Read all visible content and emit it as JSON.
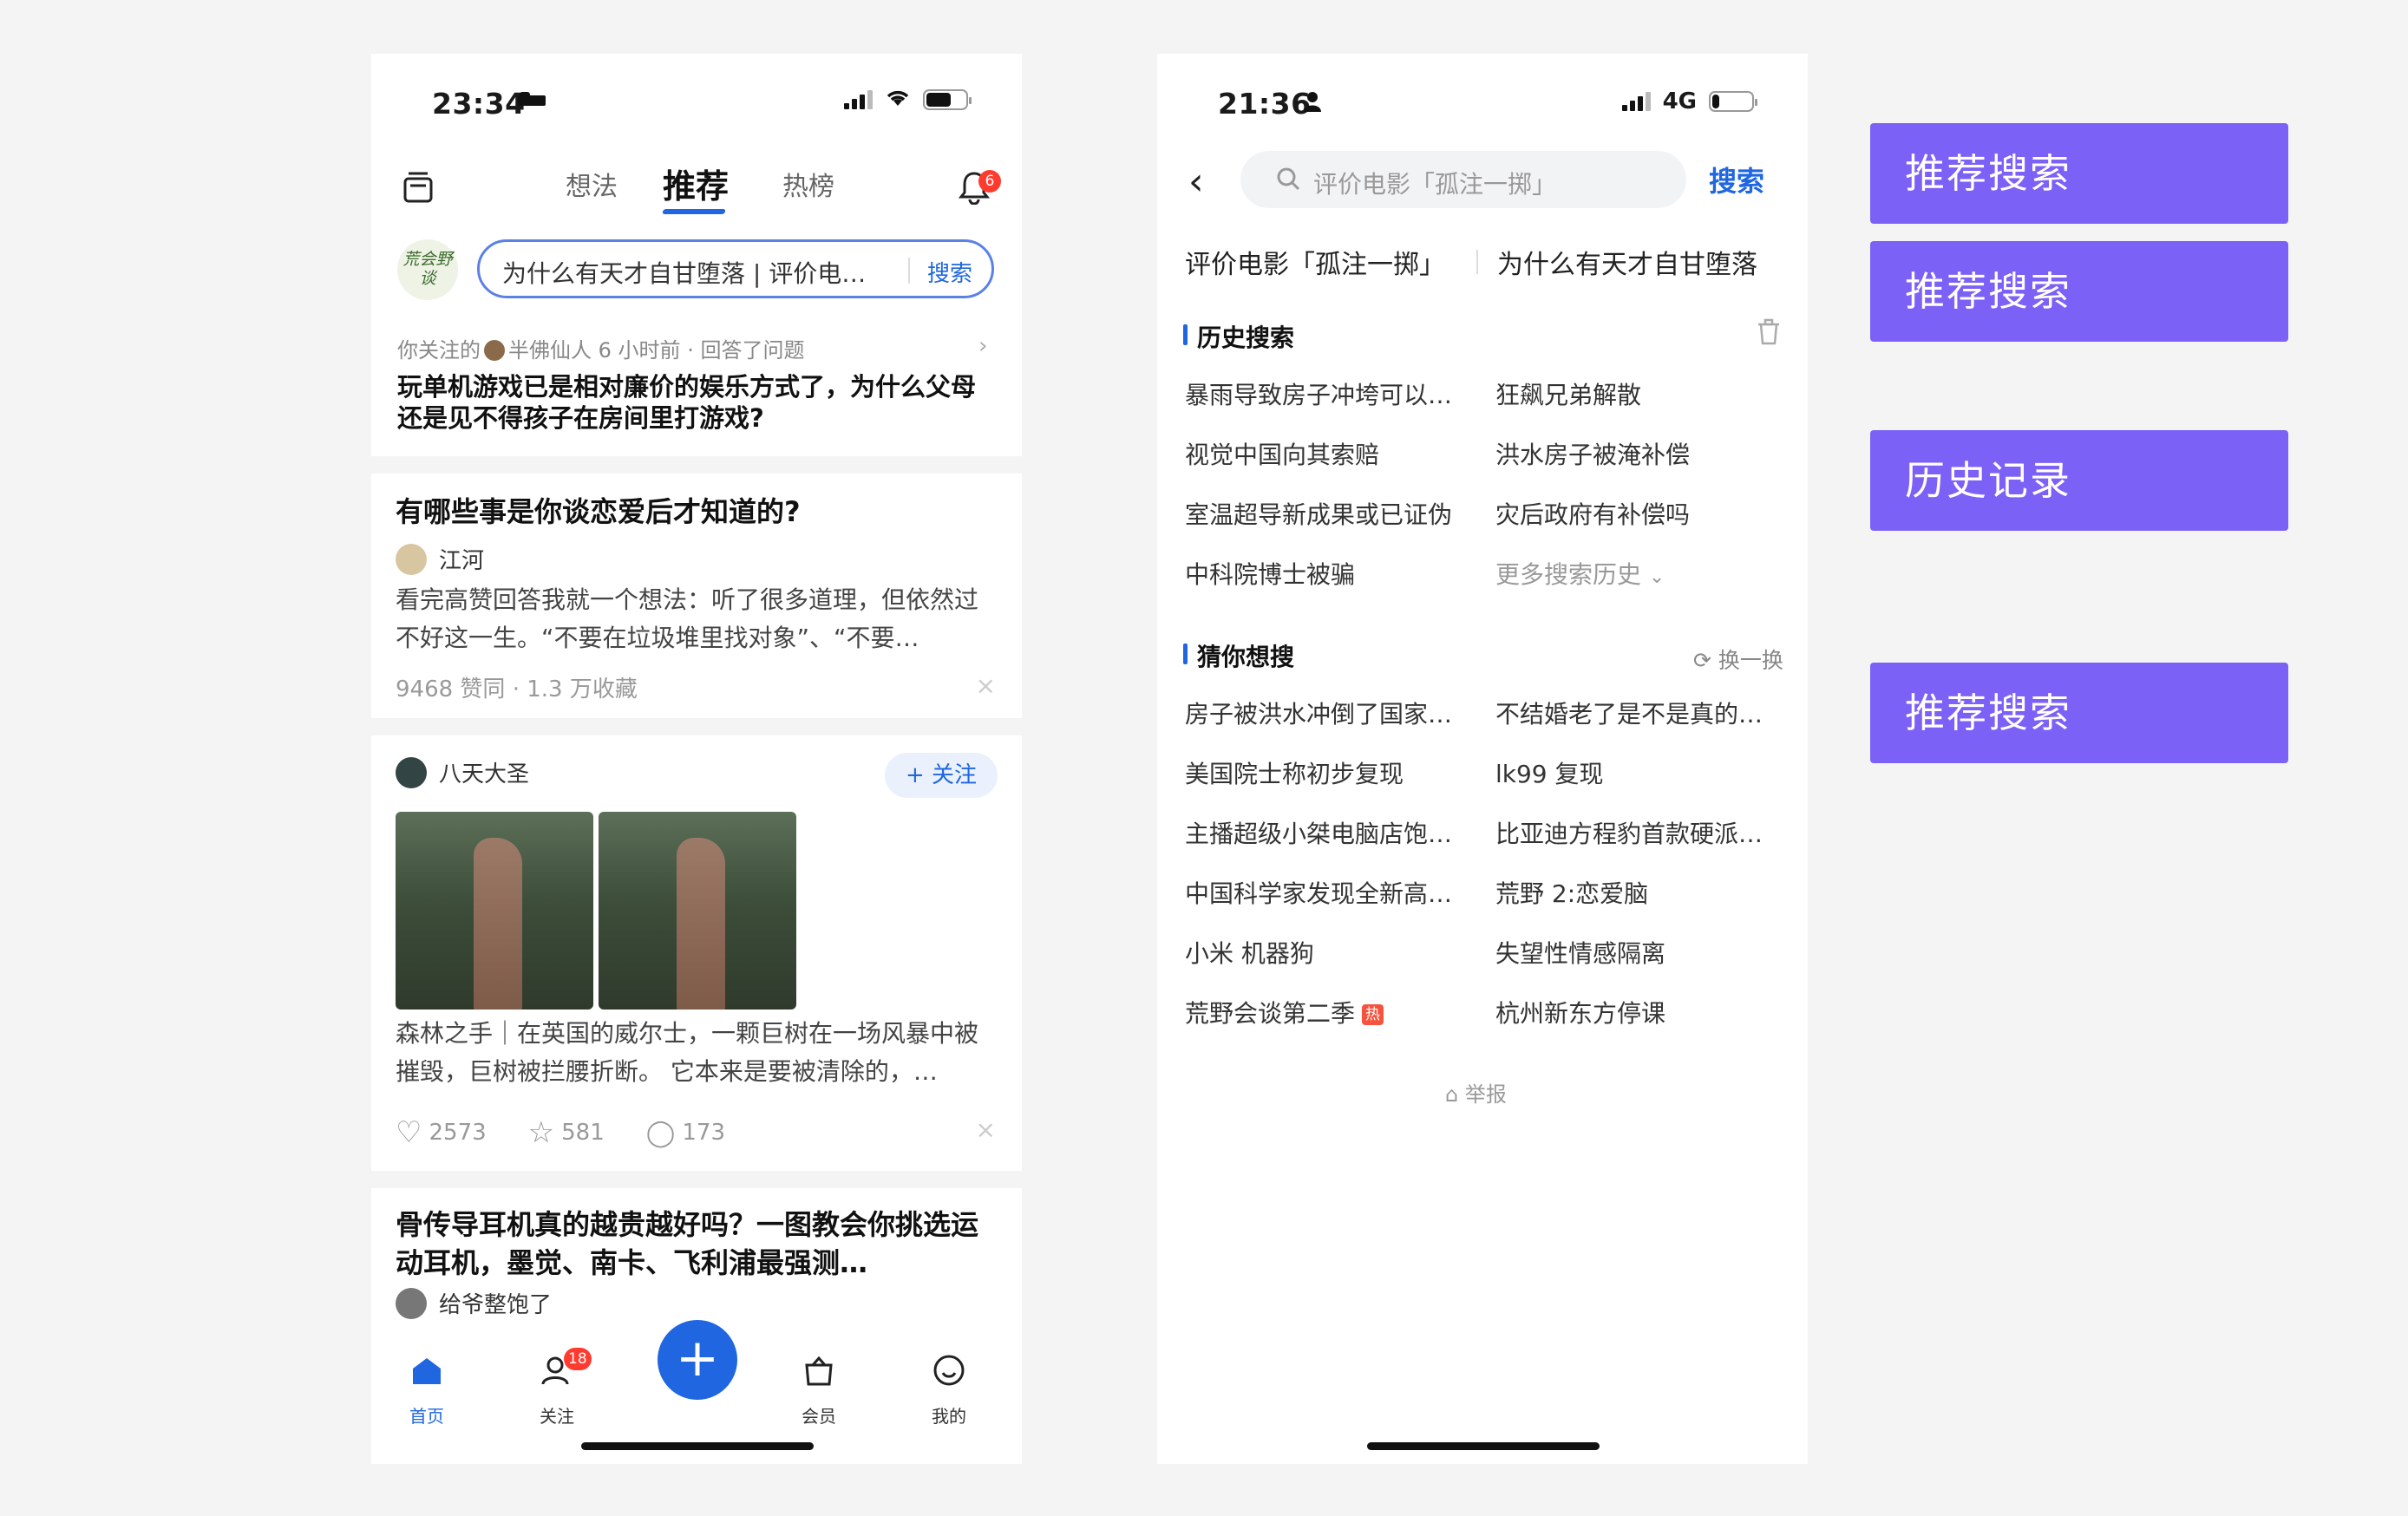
{
  "phone1": {
    "status": {
      "time": "23:34"
    },
    "tabs": [
      "想法",
      "推荐",
      "热榜"
    ],
    "bell_badge": "6",
    "search": {
      "query": "为什么有天才自甘堕落 | 评价电影「孤注一掷」",
      "button": "搜索"
    },
    "avatar_text": "荒会野谈",
    "follow": {
      "prefix": "你关注的",
      "name": "半佛仙人",
      "time": "6 小时前",
      "action": "· 回答了问题",
      "title": "玩单机游戏已是相对廉价的娱乐方式了，为什么父母还是见不得孩子在房间里打游戏?"
    },
    "card1": {
      "title": "有哪些事是你谈恋爱后才知道的?",
      "author": "江河",
      "excerpt": "看完高赞回答我就一个想法：听了很多道理，但依然过不好这一生。“不要在垃圾堆里找对象”、“不要…",
      "meta": "9468 赞同 · 1.3 万收藏"
    },
    "card2": {
      "author": "八天大圣",
      "follow": "+ 关注",
      "excerpt": "森林之手｜在英国的威尔士，一颗巨树在一场风暴中被摧毁，巨树被拦腰折断。 它本来是要被清除的，…",
      "likes": "2573",
      "stars": "581",
      "comments": "173"
    },
    "card3": {
      "title": "骨传导耳机真的越贵越好吗？一图教会你挑选运动耳机，墨觉、南卡、飞利浦最强测…",
      "author": "给爷整饱了"
    },
    "tabbar": {
      "home": "首页",
      "follow": "关注",
      "follow_badge": "18",
      "member": "会员",
      "me": "我的"
    }
  },
  "phone2": {
    "status": {
      "time": "21:36",
      "network": "4G"
    },
    "search": {
      "placeholder": "评价电影「孤注一掷」",
      "button": "搜索"
    },
    "hot_terms": [
      "评价电影「孤注一掷」",
      "为什么有天才自甘堕落"
    ],
    "history": {
      "title": "历史搜索",
      "items": [
        "暴雨导致房子冲垮可以…",
        "狂飙兄弟解散",
        "视觉中国向其索赔",
        "洪水房子被淹补偿",
        "室温超导新成果或已证伪",
        "灾后政府有补偿吗",
        "中科院博士被骗"
      ],
      "more": "更多搜索历史"
    },
    "guess": {
      "title": "猜你想搜",
      "refresh": "换一换",
      "items": [
        "房子被洪水冲倒了国家…",
        "不结婚老了是不是真的…",
        "美国院士称初步复现",
        "lk99 复现",
        "主播超级小桀电脑店饱…",
        "比亚迪方程豹首款硬派…",
        "中国科学家发现全新高…",
        "荒野 2:恋爱脑",
        "小米 机器狗",
        "失望性情感隔离",
        "荒野会谈第二季",
        "杭州新东方停课"
      ],
      "hot_tag": "热"
    },
    "report": "举报"
  },
  "labels": [
    "推荐搜索",
    "推荐搜索",
    "历史记录",
    "推荐搜索"
  ],
  "colors": {
    "accent": "#1f66e0",
    "label_bg": "#7b61f5",
    "badge": "#ff3b30"
  }
}
